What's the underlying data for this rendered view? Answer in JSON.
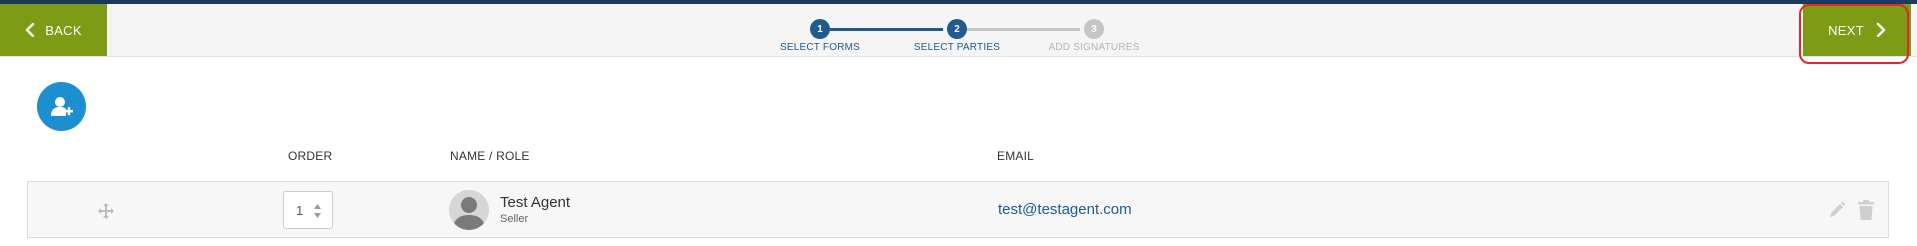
{
  "header": {
    "back_label": "BACK",
    "next_label": "NEXT",
    "steps": [
      {
        "number": "1",
        "label": "SELECT FORMS",
        "state": "complete"
      },
      {
        "number": "2",
        "label": "SELECT PARTIES",
        "state": "active"
      },
      {
        "number": "3",
        "label": "ADD SIGNATURES",
        "state": "upcoming"
      }
    ]
  },
  "actions": {
    "add_party_icon": "add-user-icon"
  },
  "table": {
    "headers": {
      "order": "ORDER",
      "name_role": "NAME / ROLE",
      "email": "EMAIL"
    },
    "rows": [
      {
        "order": "1",
        "name": "Test Agent",
        "role": "Seller",
        "email": "test@testagent.com"
      }
    ]
  },
  "colors": {
    "accent_green": "#7d9b14",
    "step_active": "#1f5b8e",
    "step_inactive": "#c5c5c5",
    "add_button": "#1b8fd0",
    "highlight_outline": "#e32626",
    "topbar": "#1b3a5a"
  }
}
